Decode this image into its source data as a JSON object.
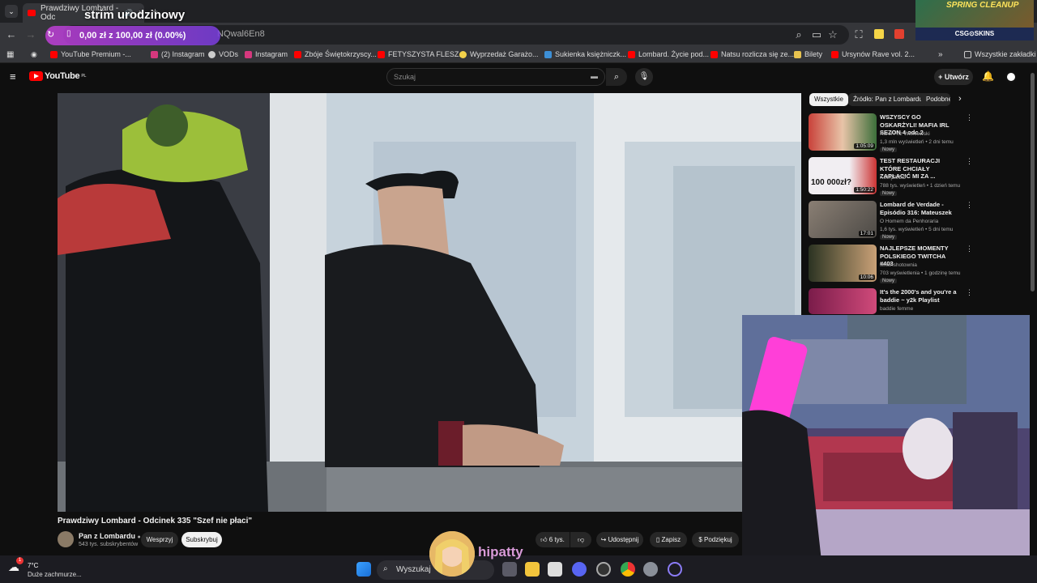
{
  "browser": {
    "tab_title": "Prawdziwy Lombard - Odc",
    "address_fragment": "NQwal6En8",
    "bookmarks": [
      "YouTube Premium -...",
      "(2) Instagram",
      "VODs",
      "Instagram",
      "Zbóje Świętokrzyscy...",
      "FETYSZYSTA FLESZ...",
      "Wyprzedaż Garażo...",
      "Sukienka księżniczk...",
      "Lombard. Życie pod...",
      "Natsu rozlicza się ze...",
      "Bilety",
      "Ursynów Rave vol. 2..."
    ],
    "all_bookmarks": "Wszystkie zakładki",
    "more": "»"
  },
  "stream_overlay": {
    "title": "strim urodzinowy",
    "donation_goal": "0,00 zł z 100,00 zł (0.00%)",
    "sponsor_top": "SPRING CLEANUP",
    "sponsor_bottom": "CSG⊙SKINS",
    "viewer_name": "hipatty"
  },
  "youtube": {
    "logo_text": "YouTube",
    "logo_region": "PL",
    "search_placeholder": "Szukaj",
    "create_label": "+ Utwórz",
    "video_title": "Prawdziwy Lombard - Odcinek 335 \"Szef nie płaci\"",
    "channel_name": "Pan z Lombardu",
    "channel_subs": "543 tys. subskrybentów",
    "support_label": "Wesprzyj",
    "subscribe_label": "Subskrybuj",
    "likes": "6 tys.",
    "share_label": "Udostępnij",
    "save_label": "Zapisz",
    "thanks_label": "Podziękuj",
    "chips": [
      "Wszystkie",
      "Źródło: Pan z Lombardu",
      "Podobne"
    ],
    "recommendations": [
      {
        "title": "WSZYSCY GO OSKARŻYLI! MAFIA IRL SEZON 4 odc.2",
        "channel": "Karol Friz Wiśniewski",
        "meta": "1,3 mln wyświetleń • 2 dni temu",
        "duration": "1:05:09",
        "badge": "Nowy",
        "thumb_color": "#c9423a"
      },
      {
        "title": "TEST RESTAURACJI KTÓRE CHCIAŁY ZAPŁACIĆ MI ZA ...",
        "channel": "KSIĄŻULO",
        "meta": "788 tys. wyświetleń • 1 dzień temu",
        "duration": "1:50:22",
        "badge": "Nowy",
        "thumb_color": "#e9e6ea",
        "thumb_text": "100 000zł?"
      },
      {
        "title": "Lombard de Verdade - Episódio 316: Mateuszek",
        "channel": "O Homem da Penhoraria",
        "meta": "1,6 tys. wyświetleń • 5 dni temu",
        "duration": "17:01",
        "badge": "Nowy",
        "thumb_color": "#6d6a63"
      },
      {
        "title": "NAJLEPSZE MOMENTY POLSKIEGO TWITCHA #403",
        "channel": "twitchshotownia",
        "meta": "703 wyświetlenia • 1 godzinę temu",
        "duration": "10:06",
        "badge": "Nowy",
        "thumb_color": "#3d4a2e"
      },
      {
        "title": "It's the 2000's and you're a baddie ~ y2k Playlist",
        "channel": "baddie femme",
        "meta": "",
        "duration": "",
        "badge": "",
        "thumb_color": "#b02a5a"
      }
    ]
  },
  "taskbar": {
    "temperature": "7°C",
    "weather": "Duże zachmurze...",
    "search_label": "Wyszukaj",
    "notif_count": "1"
  }
}
